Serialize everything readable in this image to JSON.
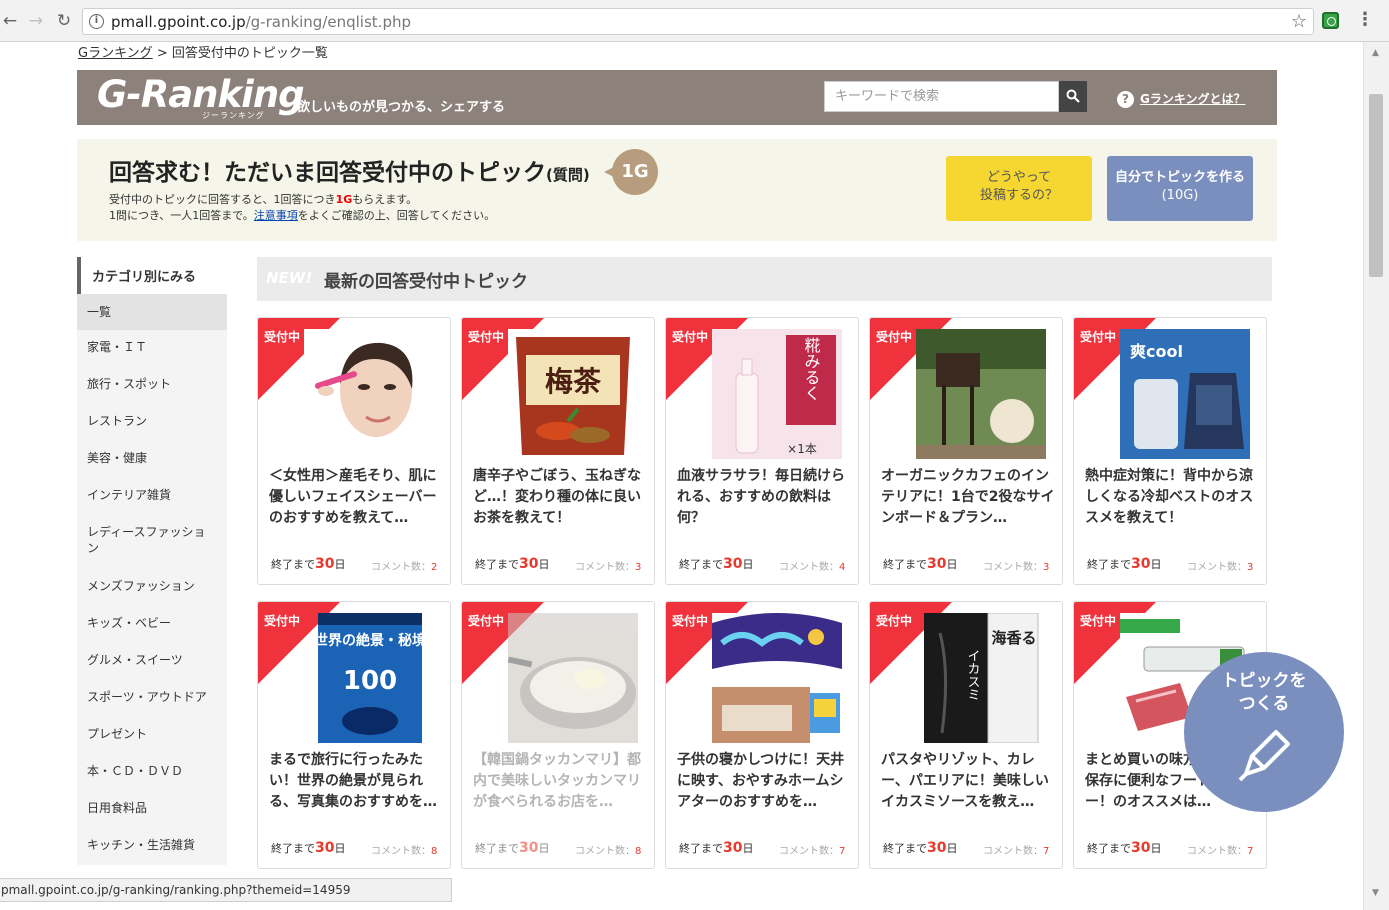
{
  "browser": {
    "url_host": "pmall.gpoint.co.jp",
    "url_path": "/g-ranking/enqlist.php"
  },
  "breadcrumb": {
    "home": "Gランキング",
    "separator": ">",
    "current": "回答受付中のトピック一覧"
  },
  "header": {
    "logo": "G-Ranking",
    "logo_sub": "ジーランキング",
    "tagline": "欲しいものが見つかる、シェアする",
    "search_placeholder": "キーワードで検索",
    "help_mark": "?",
    "about_link": "Gランキングとは？"
  },
  "intro": {
    "title": "回答求む！ただいま回答受付中のトピック",
    "title_small": "(質問)",
    "badge": "1G",
    "line1_a": "受付中のトピックに回答すると、1回答につき",
    "line1_red": "1G",
    "line1_b": "もらえます。",
    "line2_a": "1問につき、一人1回答まで。",
    "line2_link": "注意事項",
    "line2_b": "をよくご確認の上、回答してください。",
    "howto_line1": "どうやって",
    "howto_line2": "投稿するの？",
    "create_line1": "自分でトピックを作る",
    "create_line2": "(10G)"
  },
  "sidebar": {
    "heading": "カテゴリ別にみる",
    "items": [
      {
        "label": "一覧"
      },
      {
        "label": "家電・ＩＴ"
      },
      {
        "label": "旅行・スポット"
      },
      {
        "label": "レストラン"
      },
      {
        "label": "美容・健康"
      },
      {
        "label": "インテリア雑貨"
      },
      {
        "label": "レディースファッション"
      },
      {
        "label": "メンズファッション"
      },
      {
        "label": "キッズ・ベビー"
      },
      {
        "label": "グルメ・スイーツ"
      },
      {
        "label": "スポーツ・アウトドア"
      },
      {
        "label": "プレゼント"
      },
      {
        "label": "本・ＣＤ・ＤＶＤ"
      },
      {
        "label": "日用食料品"
      },
      {
        "label": "キッチン・生活雑貨"
      }
    ]
  },
  "main": {
    "new_mark": "NEW!",
    "heading": "最新の回答受付中トピック",
    "ribbon": "受付中",
    "days_prefix": "終了まで",
    "days_suffix": "日",
    "comment_label": "コメント数：",
    "cards": [
      {
        "title": "＜女性用＞産毛そり、肌に優しいフェイスシェーバーのおすすめを教えて…",
        "days": "30",
        "comments": "2"
      },
      {
        "title": "唐辛子やごぼう、玉ねぎなど…！変わり種の体に良いお茶を教えて！",
        "days": "30",
        "comments": "3",
        "thumb_text": "梅茶"
      },
      {
        "title": "血液サラサラ！毎日続けられる、おすすめの飲料は何？",
        "days": "30",
        "comments": "4",
        "thumb_text": "糀みるく",
        "thumb_text2": "×1本"
      },
      {
        "title": "オーガニックカフェのインテリアに！1台で2役なサインボード＆プラン…",
        "days": "30",
        "comments": "3"
      },
      {
        "title": "熱中症対策に！背中から涼しくなる冷却ベストのオススメを教えて！",
        "days": "30",
        "comments": "3",
        "thumb_text": "爽cool"
      },
      {
        "title": "まるで旅行に行ったみたい！世界の絶景が見られる、写真集のおすすめを…",
        "days": "30",
        "comments": "8",
        "thumb_text": "世界の絶景・秘境",
        "thumb_text2": "100"
      },
      {
        "title": "【韓国鍋タッカンマリ】都内で美味しいタッカンマリが食べられるお店を…",
        "days": "30",
        "comments": "8"
      },
      {
        "title": "子供の寝かしつけに！天井に映す、おやすみホームシアターのおすすめを…",
        "days": "30",
        "comments": "7"
      },
      {
        "title": "パスタやリゾット、カレー、パエリアに！美味しいイカスミソースを教え…",
        "days": "30",
        "comments": "7",
        "thumb_text": "海香る",
        "thumb_text2": "イカスミ"
      },
      {
        "title": "まとめ買いの味方！食材の保存に便利なフードシーラー！のオススメは…",
        "days": "30",
        "comments": "7"
      }
    ]
  },
  "fab": {
    "line1": "トピックを",
    "line2": "つくる"
  },
  "status_url": "pmall.gpoint.co.jp/g-ranking/ranking.php?themeid=14959",
  "colors": {
    "header_bg": "#8c817b",
    "ribbon_red": "#f0323c",
    "howto_yellow": "#f6d631",
    "create_blue": "#7b8fbe",
    "intro_bg": "#f5f5ea"
  }
}
